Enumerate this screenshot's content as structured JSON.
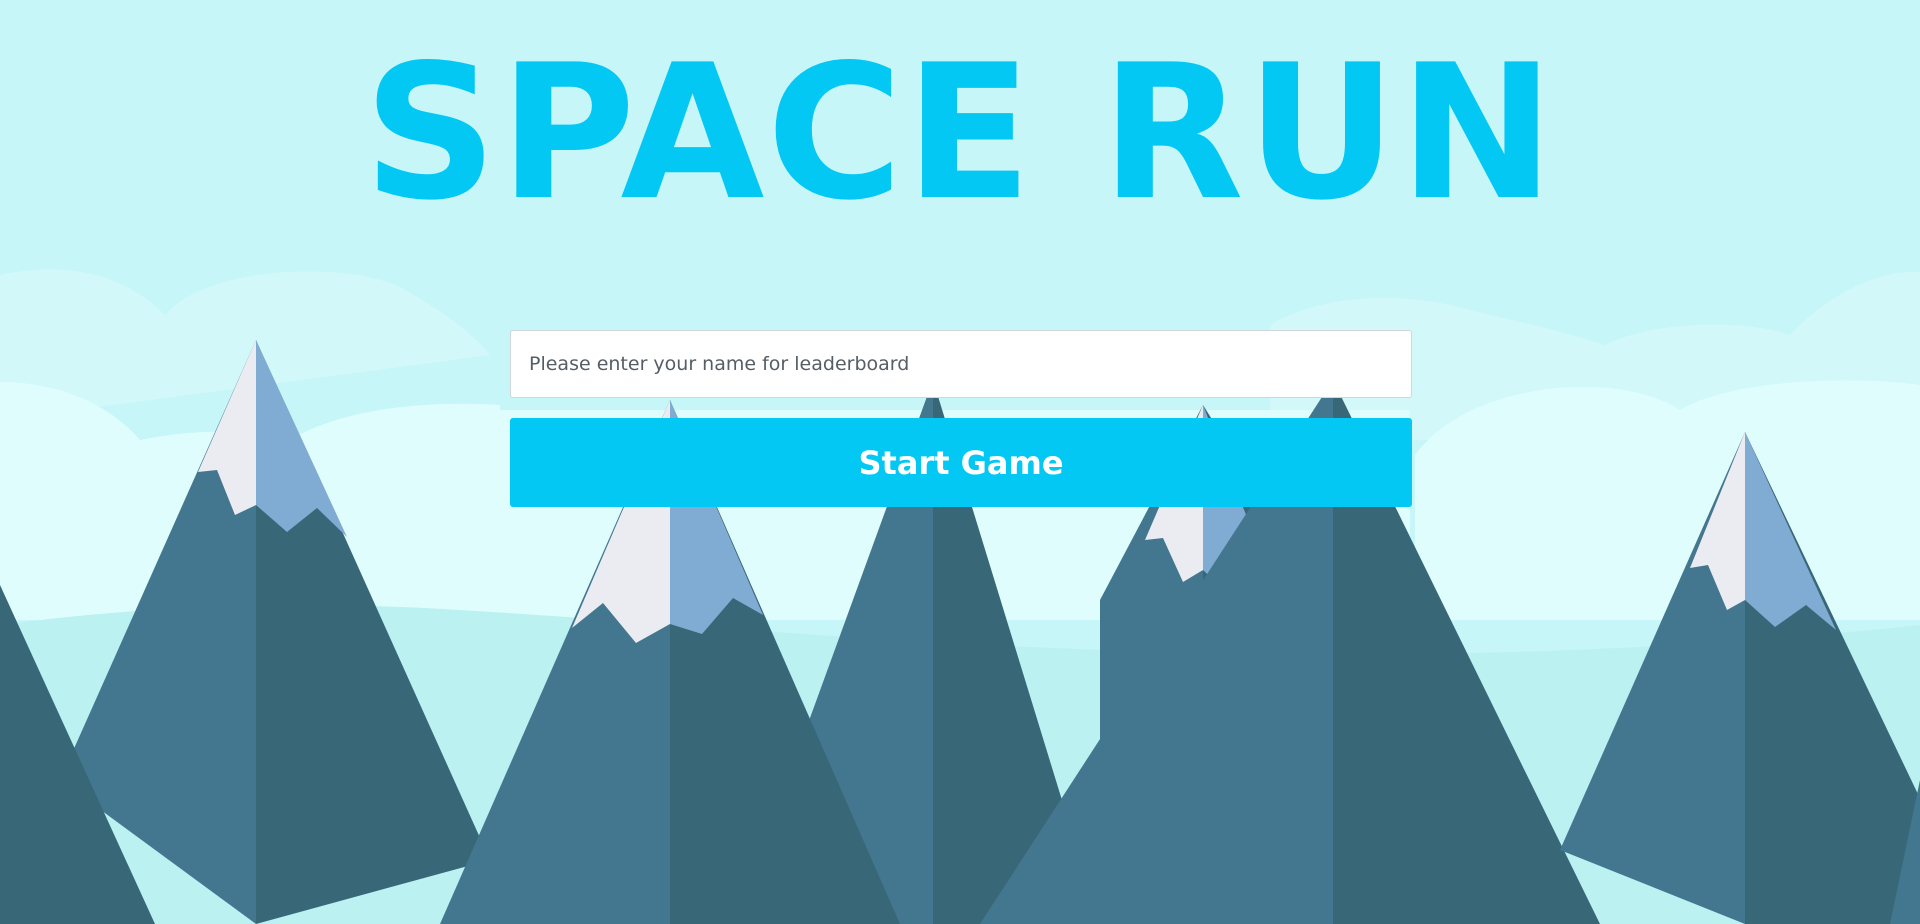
{
  "game": {
    "title": "SPACE RUN"
  },
  "form": {
    "name_placeholder": "Please enter your name for leaderboard",
    "name_value": "",
    "start_label": "Start Game"
  },
  "colors": {
    "accent": "#03c8f3",
    "sky": "#c6f6f8",
    "mountain_light": "#42778f",
    "mountain_dark": "#386778",
    "snow_light": "#ebebf2",
    "snow_shadow": "#80abd2"
  }
}
